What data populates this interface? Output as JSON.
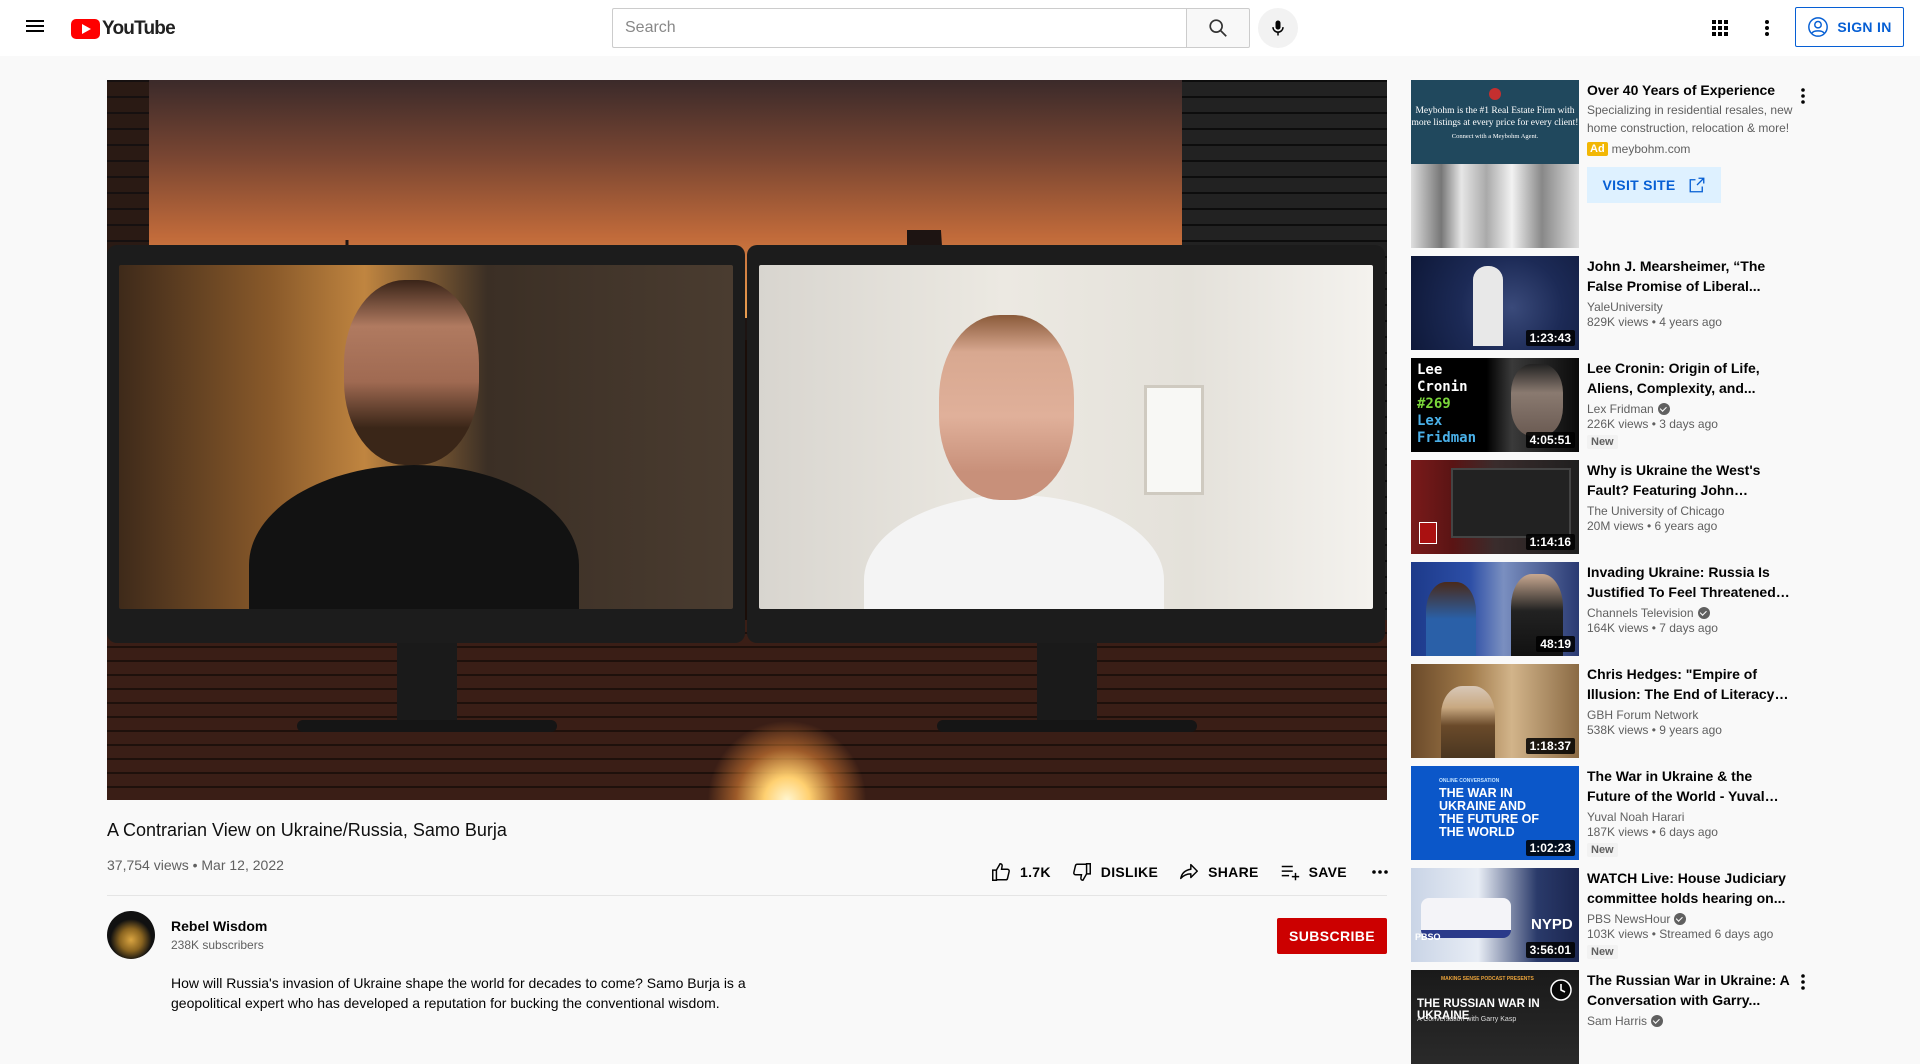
{
  "header": {
    "logo_text": "YouTube",
    "search_placeholder": "Search",
    "signin_label": "SIGN IN"
  },
  "video": {
    "title": "A Contrarian View on Ukraine/Russia, Samo Burja",
    "meta": "37,754 views • Mar 12, 2022",
    "likes": "1.7K",
    "dislike_label": "DISLIKE",
    "share_label": "SHARE",
    "save_label": "SAVE"
  },
  "channel": {
    "name": "Rebel Wisdom",
    "subscribers": "238K subscribers",
    "subscribe_label": "SUBSCRIBE"
  },
  "description": "How will Russia's invasion of Ukraine shape the world for decades to come? Samo Burja is a geopolitical expert who has developed a reputation for bucking the conventional wisdom.",
  "ad": {
    "thumb_line": "Meybohm is the #1 Real Estate Firm with more listings at every price for every client!",
    "thumb_small": "Connect with a Meybohm Agent.",
    "title": "Over 40 Years of Experience",
    "desc": "Specializing in residential resales, new home construction, relocation & more!",
    "badge": "Ad",
    "domain": "meybohm.com",
    "visit_label": "VISIT SITE"
  },
  "recommendations": [
    {
      "title": "John J. Mearsheimer, “The False Promise of Liberal...",
      "channel": "YaleUniversity",
      "verified": false,
      "meta": "829K views • 4 years ago",
      "duration": "1:23:43",
      "badge": ""
    },
    {
      "title": "Lee Cronin: Origin of Life, Aliens, Complexity, and...",
      "channel": "Lex Fridman",
      "verified": true,
      "meta": "226K views • 3 days ago",
      "duration": "4:05:51",
      "badge": "New"
    },
    {
      "title": "Why is Ukraine the West's Fault? Featuring John Mearsheimer",
      "channel": "The University of Chicago",
      "verified": false,
      "meta": "20M views • 6 years ago",
      "duration": "1:14:16",
      "badge": ""
    },
    {
      "title": "Invading Ukraine: Russia Is Justified To Feel Threatened -...",
      "channel": "Channels Television",
      "verified": true,
      "meta": "164K views • 7 days ago",
      "duration": "48:19",
      "badge": ""
    },
    {
      "title": "Chris Hedges: \"Empire of Illusion: The End of Literacy an...",
      "channel": "GBH Forum Network",
      "verified": false,
      "meta": "538K views • 9 years ago",
      "duration": "1:18:37",
      "badge": ""
    },
    {
      "title": "The War in Ukraine & the Future of the World - Yuval Noah Hara...",
      "channel": "Yuval Noah Harari",
      "verified": false,
      "meta": "187K views • 6 days ago",
      "duration": "1:02:23",
      "badge": "New"
    },
    {
      "title": "WATCH Live: House Judiciary committee holds hearing on...",
      "channel": "PBS NewsHour",
      "verified": true,
      "meta": "103K views • Streamed 6 days ago",
      "duration": "3:56:01",
      "badge": "New"
    },
    {
      "title": "The Russian War in Ukraine: A Conversation with Garry...",
      "channel": "Sam Harris",
      "verified": true,
      "meta": "",
      "duration": "",
      "badge": ""
    }
  ],
  "thumb_texts": {
    "lex": [
      "Lee",
      "Cronin",
      "#269",
      "Lex",
      "Fridman"
    ],
    "harari_small": "ONLINE CONVERSATION",
    "harari": "THE WAR IN UKRAINE AND THE FUTURE OF THE WORLD",
    "pbs": "PBSO",
    "nypd": "NYPD",
    "harris_small": "MAKING SENSE PODCAST PRESENTS",
    "harris": "THE RUSSIAN WAR IN UKRAINE",
    "harris_sub": "A Conversation with Garry Kasp"
  }
}
